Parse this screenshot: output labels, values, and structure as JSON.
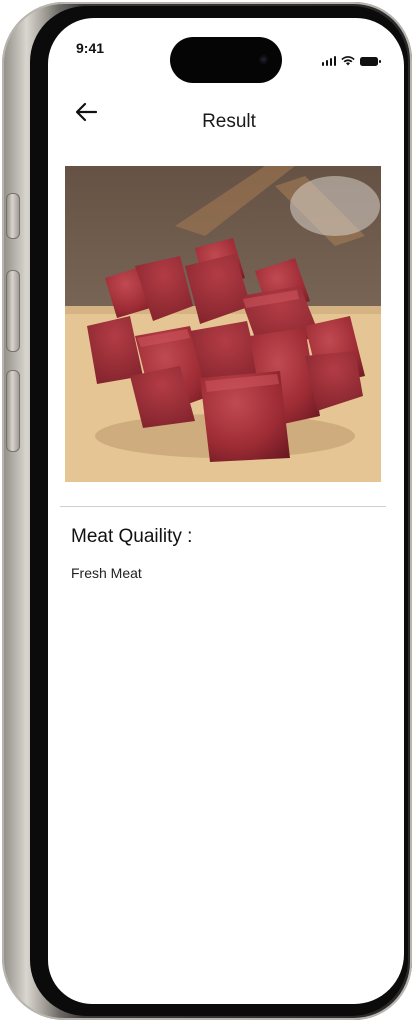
{
  "status_bar": {
    "time": "9:41"
  },
  "header": {
    "title": "Result",
    "back_icon": "arrow-left-icon"
  },
  "result_image": {
    "subject": "raw beef cubes on wooden board"
  },
  "result": {
    "label": "Meat Quaility :",
    "value": "Fresh Meat"
  },
  "colors": {
    "screen_bg": "#ffffff",
    "meat_red": "#a8323a",
    "board_wood": "#e8c89a"
  }
}
